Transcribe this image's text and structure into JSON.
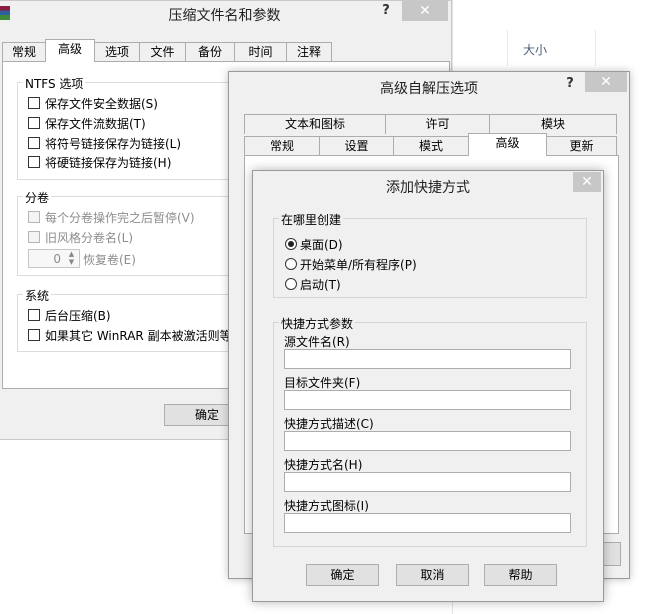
{
  "bg_window": {
    "title": "压缩文件名和参数",
    "help": "?",
    "close": "✕",
    "tabs": [
      "常规",
      "高级",
      "选项",
      "文件",
      "备份",
      "时间",
      "注释"
    ],
    "active_tab": "高级",
    "ntfs": {
      "label": "NTFS 选项",
      "items": [
        "保存文件安全数据(S)",
        "保存文件流数据(T)",
        "将符号链接保存为链接(L)",
        "将硬链接保存为链接(H)"
      ]
    },
    "volume": {
      "label": "分卷",
      "items": [
        "每个分卷操作完之后暂停(V)",
        "旧风格分卷名(L)"
      ],
      "spinner_value": "0",
      "spinner_label": "恢复卷(E)"
    },
    "system": {
      "label": "系统",
      "items": [
        "后台压缩(B)",
        "如果其它 WinRAR 副本被激活则等待"
      ]
    },
    "ok": "确定"
  },
  "far_window": {
    "column_header": "大小"
  },
  "sfx_window": {
    "title": "高级自解压选项",
    "help": "?",
    "close": "✕",
    "tabs_row1": [
      "文本和图标",
      "许可",
      "模块"
    ],
    "tabs_row2": [
      "常规",
      "设置",
      "模式",
      "高级",
      "更新"
    ],
    "active_tab": "高级"
  },
  "shortcut_dialog": {
    "title": "添加快捷方式",
    "close": "✕",
    "where": {
      "label": "在哪里创建",
      "options": [
        "桌面(D)",
        "开始菜单/所有程序(P)",
        "启动(T)"
      ],
      "selected": "桌面(D)"
    },
    "params": {
      "label": "快捷方式参数",
      "fields": [
        {
          "label": "源文件名(R)",
          "value": ""
        },
        {
          "label": "目标文件夹(F)",
          "value": ""
        },
        {
          "label": "快捷方式描述(C)",
          "value": ""
        },
        {
          "label": "快捷方式名(H)",
          "value": ""
        },
        {
          "label": "快捷方式图标(I)",
          "value": ""
        }
      ]
    },
    "buttons": {
      "ok": "确定",
      "cancel": "取消",
      "help": "帮助"
    }
  }
}
